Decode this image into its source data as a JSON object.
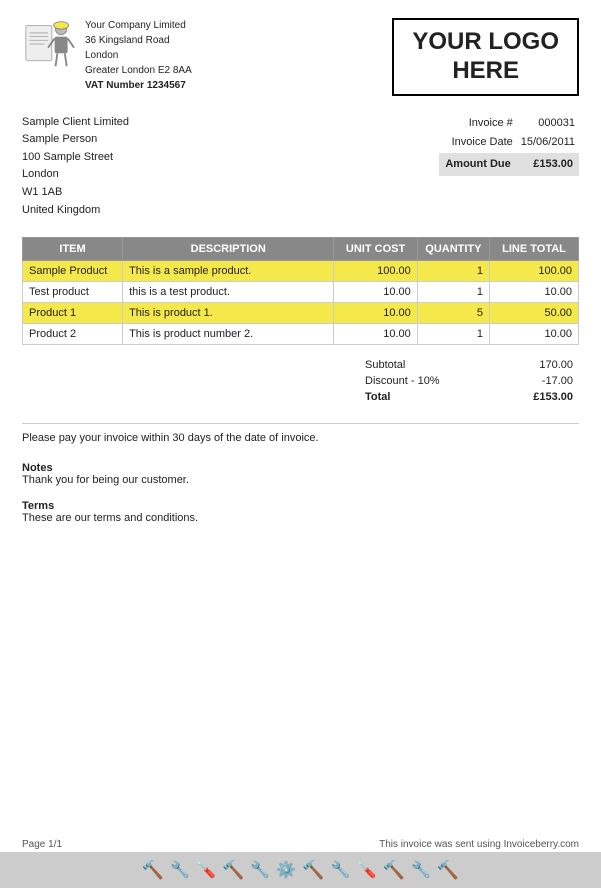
{
  "company": {
    "name": "Your Company Limited",
    "address1": "36 Kingsland Road",
    "address2": "London",
    "address3": "Greater London E2 8AA",
    "vat_label": "VAT Number",
    "vat_number": "1234567"
  },
  "logo": {
    "line1": "YOUR LOGO",
    "line2": "HERE"
  },
  "client": {
    "company": "Sample Client Limited",
    "person": "Sample Person",
    "address1": "100 Sample Street",
    "address2": "London",
    "postcode": "W1 1AB",
    "country": "United Kingdom"
  },
  "invoice": {
    "number_label": "Invoice #",
    "number_value": "000031",
    "date_label": "Invoice Date",
    "date_value": "15/06/2011",
    "amount_due_label": "Amount Due",
    "amount_due_value": "£153.00"
  },
  "table": {
    "headers": {
      "item": "ITEM",
      "description": "DESCRIPTION",
      "unit_cost": "UNIT COST",
      "quantity": "QUANTITY",
      "line_total": "LINE TOTAL"
    },
    "rows": [
      {
        "item": "Sample Product",
        "description": "This is a sample product.",
        "unit_cost": "100.00",
        "quantity": "1",
        "line_total": "100.00",
        "highlight": true
      },
      {
        "item": "Test product",
        "description": "this is a test product.",
        "unit_cost": "10.00",
        "quantity": "1",
        "line_total": "10.00",
        "highlight": false
      },
      {
        "item": "Product 1",
        "description": "This is product 1.",
        "unit_cost": "10.00",
        "quantity": "5",
        "line_total": "50.00",
        "highlight": true
      },
      {
        "item": "Product 2",
        "description": "This is product number 2.",
        "unit_cost": "10.00",
        "quantity": "1",
        "line_total": "10.00",
        "highlight": false
      }
    ]
  },
  "totals": {
    "subtotal_label": "Subtotal",
    "subtotal_value": "170.00",
    "discount_label": "Discount - 10%",
    "discount_value": "-17.00",
    "total_label": "Total",
    "total_value": "£153.00"
  },
  "payment_note": "Please pay your invoice within 30 days of the date of invoice.",
  "notes": {
    "label": "Notes",
    "text": "Thank you for being our customer."
  },
  "terms": {
    "label": "Terms",
    "text": "These are our terms and conditions."
  },
  "footer": {
    "page": "Page 1/1",
    "powered_by": "This invoice was sent using Invoiceberry.com"
  }
}
